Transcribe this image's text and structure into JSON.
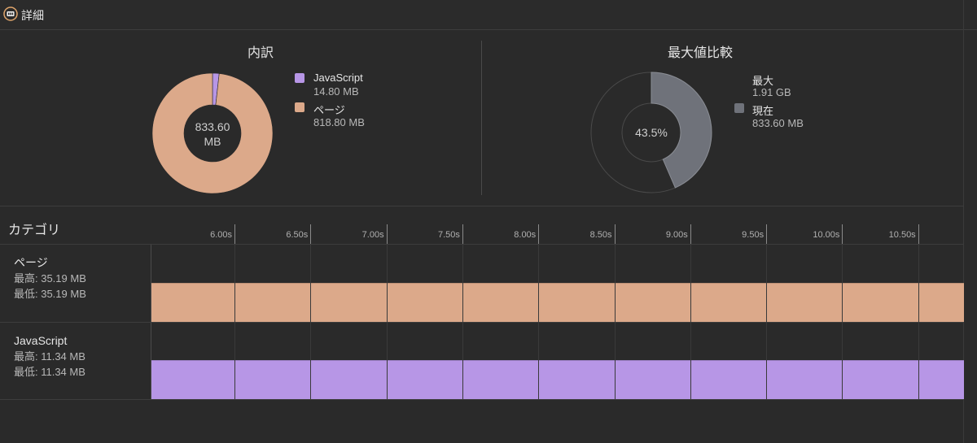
{
  "header": {
    "title": "詳細",
    "icon": "memory-chip-icon",
    "accent": "#e0a56b"
  },
  "breakdown": {
    "title": "内訳",
    "total_line1": "833.60",
    "total_line2": "MB",
    "items": [
      {
        "name": "JavaScript",
        "value": "14.80 MB",
        "mb": 14.8,
        "color": "#b796e6"
      },
      {
        "name": "ページ",
        "value": "818.80 MB",
        "mb": 818.8,
        "color": "#dca98a"
      }
    ]
  },
  "max_comparison": {
    "title": "最大値比較",
    "percent": "43.5%",
    "fraction": 0.435,
    "max_label": "最大",
    "max_value": "1.91 GB",
    "current_label": "現在",
    "current_value": "833.60 MB",
    "current_color": "#6f727a"
  },
  "categories": {
    "title": "カテゴリ",
    "ticks": [
      "6.00s",
      "6.50s",
      "7.00s",
      "7.50s",
      "8.00s",
      "8.50s",
      "9.00s",
      "9.50s",
      "10.00s",
      "10.50s"
    ],
    "rows": [
      {
        "name": "ページ",
        "max": "最高: 35.19 MB",
        "min": "最低: 35.19 MB",
        "color": "#dca98a"
      },
      {
        "name": "JavaScript",
        "max": "最高: 11.34 MB",
        "min": "最低: 11.34 MB",
        "color": "#b796e6"
      }
    ]
  }
}
